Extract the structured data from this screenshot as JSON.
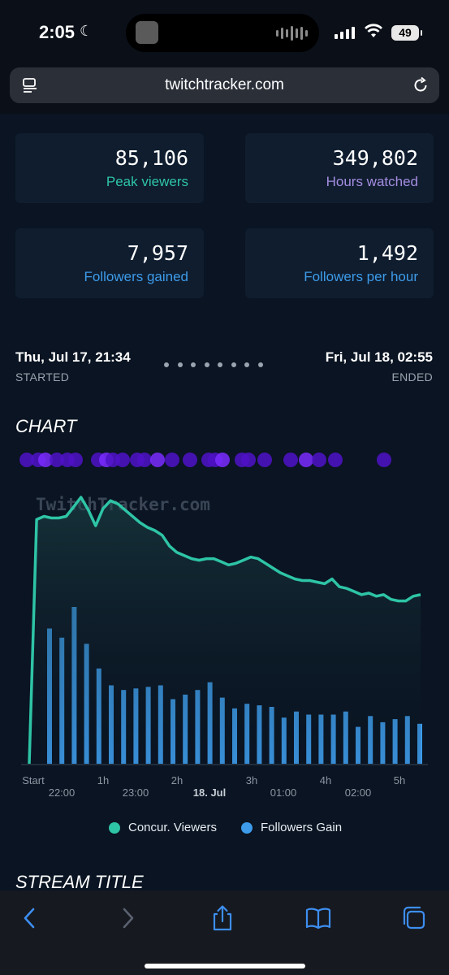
{
  "status": {
    "time": "2:05",
    "battery": "49"
  },
  "browser": {
    "url": "twitchtracker.com"
  },
  "stats": [
    {
      "value": "85,106",
      "label": "Peak viewers",
      "color": "#2ec4a6"
    },
    {
      "value": "349,802",
      "label": "Hours watched",
      "color": "#a58de0"
    },
    {
      "value": "7,957",
      "label": "Followers gained",
      "color": "#3d9be9"
    },
    {
      "value": "1,492",
      "label": "Followers per hour",
      "color": "#3d9be9"
    }
  ],
  "stream": {
    "started": "Thu, Jul 17, 21:34",
    "started_label": "STARTED",
    "ended": "Fri, Jul 18, 02:55",
    "ended_label": "ENDED"
  },
  "chart_section_title": "CHART",
  "next_section_title": "STREAM TITLE",
  "chart_data": {
    "type": "line",
    "watermark": "TwitchTracker.com",
    "x_ticks_elapsed": [
      "Start",
      "1h",
      "2h",
      "3h",
      "4h",
      "5h"
    ],
    "x_ticks_clock": [
      "22:00",
      "23:00",
      "18. Jul",
      "01:00",
      "02:00"
    ],
    "series": [
      {
        "name": "Concur. Viewers",
        "type": "area",
        "color": "#2ec4a6",
        "values": [
          0,
          78000,
          79000,
          78500,
          78500,
          79000,
          82000,
          85106,
          81000,
          76000,
          81500,
          84000,
          83000,
          81000,
          79000,
          77000,
          75500,
          74500,
          73000,
          69500,
          67500,
          66500,
          65500,
          65000,
          65500,
          65500,
          64500,
          63500,
          64000,
          65000,
          66000,
          65500,
          64000,
          62500,
          61000,
          60000,
          59000,
          58500,
          58500,
          58000,
          57500,
          59000,
          56500,
          56000,
          55000,
          54000,
          54500,
          53500,
          54000,
          52500,
          52000,
          52000,
          53500,
          54000
        ]
      },
      {
        "name": "Followers Gain",
        "type": "bar",
        "color": "#3d9be9",
        "values": [
          440,
          410,
          510,
          390,
          310,
          255,
          240,
          245,
          250,
          255,
          210,
          225,
          240,
          265,
          215,
          180,
          195,
          190,
          185,
          150,
          170,
          160,
          160,
          160,
          170,
          120,
          155,
          135,
          145,
          155,
          130
        ]
      }
    ],
    "events_markers": 22,
    "legend_position": "bottom"
  }
}
